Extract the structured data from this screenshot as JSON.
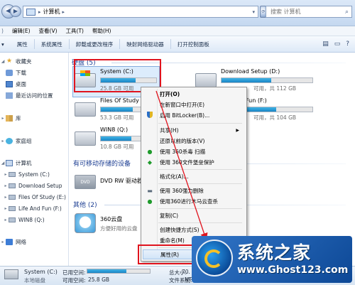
{
  "address_bar": {
    "path": "计算机"
  },
  "search": {
    "placeholder": "搜索 计算机"
  },
  "menu": [
    "编辑(E)",
    "查看(V)",
    "工具(T)",
    "帮助(H)"
  ],
  "toolbar": [
    "属性",
    "系统属性",
    "卸载或更改程序",
    "映射网络驱动器",
    "打开控制面板"
  ],
  "nav": {
    "favorites": "收藏夹",
    "downloads": "下载",
    "desktop": "桌面",
    "recent": "最近访问的位置",
    "libraries": "库",
    "homegroup": "家庭组",
    "computer": "计算机",
    "drives": [
      "System (C:)",
      "Download Setup",
      "Files Of Study (E:)",
      "Life And Fun (F:)",
      "WIN8 (Q:)"
    ],
    "network": "网络"
  },
  "groups": {
    "hdd": "硬盘 (5)",
    "removable": "有可移动存储的设备",
    "other": "其他 (2)"
  },
  "drives": [
    {
      "name": "System (C:)",
      "free_text": "25.8 GB 可用",
      "used_fraction": 0.63
    },
    {
      "name": "Download Setup (D:)",
      "free_text": "可用，共 112 GB",
      "used_fraction": 0.55
    },
    {
      "name": "Files Of Study",
      "free_text": "53.3 GB 可用",
      "used_fraction": 0.58
    },
    {
      "name": "Fun (F:)",
      "free_text": "可用，共 104 GB",
      "used_fraction": 0.6
    },
    {
      "name": "WIN8 (Q:)",
      "free_text": "10.8 GB 可用",
      "used_fraction": 0.55
    }
  ],
  "dvd": {
    "name": "DVD RW 驱动器",
    "badge": "DVD"
  },
  "cloud": {
    "name": "360云盘",
    "subtitle": "方便好用的云盘"
  },
  "context_menu": {
    "open": "打开(O)",
    "open_new_window": "在新窗口中打开(E)",
    "bitlocker": "启用 BitLocker(B)...",
    "share": "共享(H)",
    "restore": "还原以前的版本(V)",
    "scan360": "使用 360杀毒 扫描",
    "shield360": "使用 360文件堡垒保护",
    "format": "格式化(A)...",
    "delete360": "使用 360强力删除",
    "trojan360": "使用360进行木马云查杀",
    "copy": "复制(C)",
    "shortcut": "创建快捷方式(S)",
    "rename": "重命名(M)",
    "properties": "属性(R)"
  },
  "statusbar": {
    "drive_name": "System (C:)",
    "type": "本地磁盘",
    "used_label": "已用空间:",
    "free_label": "可用空间:",
    "free_value": "25.8 GB",
    "total_label": "总大小:",
    "total_value": "70.",
    "fs_label": "文件系统:",
    "fs_value": "NT",
    "used_fraction": 0.63
  },
  "watermark": {
    "title": "系统之家",
    "url": "www.Ghost123.com"
  },
  "colors": {
    "accent": "#1b3d92",
    "highlight_box": "#e0141e",
    "bar_fill": "#1a85c5"
  }
}
